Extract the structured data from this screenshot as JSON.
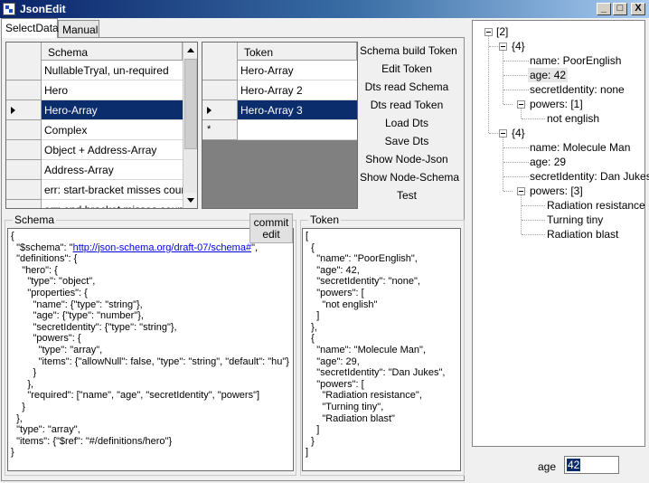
{
  "window": {
    "title": "JsonEdit",
    "minimize": "_",
    "maximize": "□",
    "close": "X"
  },
  "tabs": [
    {
      "label": "SelectData"
    },
    {
      "label": "Manual"
    }
  ],
  "schema_grid": {
    "header": "Schema",
    "rows": [
      "NullableTryal, un-required",
      "Hero",
      "Hero-Array",
      "Complex",
      "Object + Address-Array",
      "Address-Array",
      "err: start-bracket misses coun...",
      "err: end bracket misses count"
    ],
    "selected_index": 2
  },
  "token_grid": {
    "header": "Token",
    "rows": [
      "Hero-Array",
      "Hero-Array 2",
      "Hero-Array 3"
    ],
    "selected_index": 2,
    "new_row_marker": "*"
  },
  "actions": [
    "Schema build Token",
    "Edit Token",
    "Dts read Schema",
    "Dts read Token",
    "Load Dts",
    "Save Dts",
    "Show Node-Json",
    "Show Node-Schema",
    "Test"
  ],
  "schema_group": {
    "title": "Schema",
    "commit_label_1": "commit",
    "commit_label_2": "edit",
    "text": {
      "l0": "{",
      "l1a": "  \"$schema\": \"",
      "l1link": "http://json-schema.org/draft-07/schema#",
      "l1b": "\",",
      "rest": "  \"definitions\": {\n    \"hero\": {\n      \"type\": \"object\",\n      \"properties\": {\n        \"name\": {\"type\": \"string\"},\n        \"age\": {\"type\": \"number\"},\n        \"secretIdentity\": {\"type\": \"string\"},\n        \"powers\": {\n          \"type\": \"array\",\n          \"items\": {\"allowNull\": false, \"type\": \"string\", \"default\": \"hu\"}\n        }\n      },\n      \"required\": [\"name\", \"age\", \"secretIdentity\", \"powers\"]\n    }\n  },\n  \"type\": \"array\",\n  \"items\": {\"$ref\": \"#/definitions/hero\"}\n}"
    }
  },
  "token_group": {
    "title": "Token",
    "text": "[\n  {\n    \"name\": \"PoorEnglish\",\n    \"age\": 42,\n    \"secretIdentity\": \"none\",\n    \"powers\": [\n      \"not english\"\n    ]\n  },\n  {\n    \"name\": \"Molecule Man\",\n    \"age\": 29,\n    \"secretIdentity\": \"Dan Jukes\",\n    \"powers\": [\n      \"Radiation resistance\",\n      \"Turning tiny\",\n      \"Radiation blast\"\n    ]\n  }\n]"
  },
  "tree": {
    "root": "[2]",
    "items": [
      {
        "label": "{4}"
      },
      {
        "label": "name: PoorEnglish"
      },
      {
        "label": "age: 42"
      },
      {
        "label": "secretIdentity: none"
      },
      {
        "label": "powers: [1]"
      },
      {
        "label": "not english"
      },
      {
        "label": "{4}"
      },
      {
        "label": "name: Molecule Man"
      },
      {
        "label": "age: 29"
      },
      {
        "label": "secretIdentity: Dan Jukes"
      },
      {
        "label": "powers: [3]"
      },
      {
        "label": "Radiation resistance"
      },
      {
        "label": "Turning tiny"
      },
      {
        "label": "Radiation blast"
      }
    ]
  },
  "age_field": {
    "label": "age",
    "value": "42"
  }
}
